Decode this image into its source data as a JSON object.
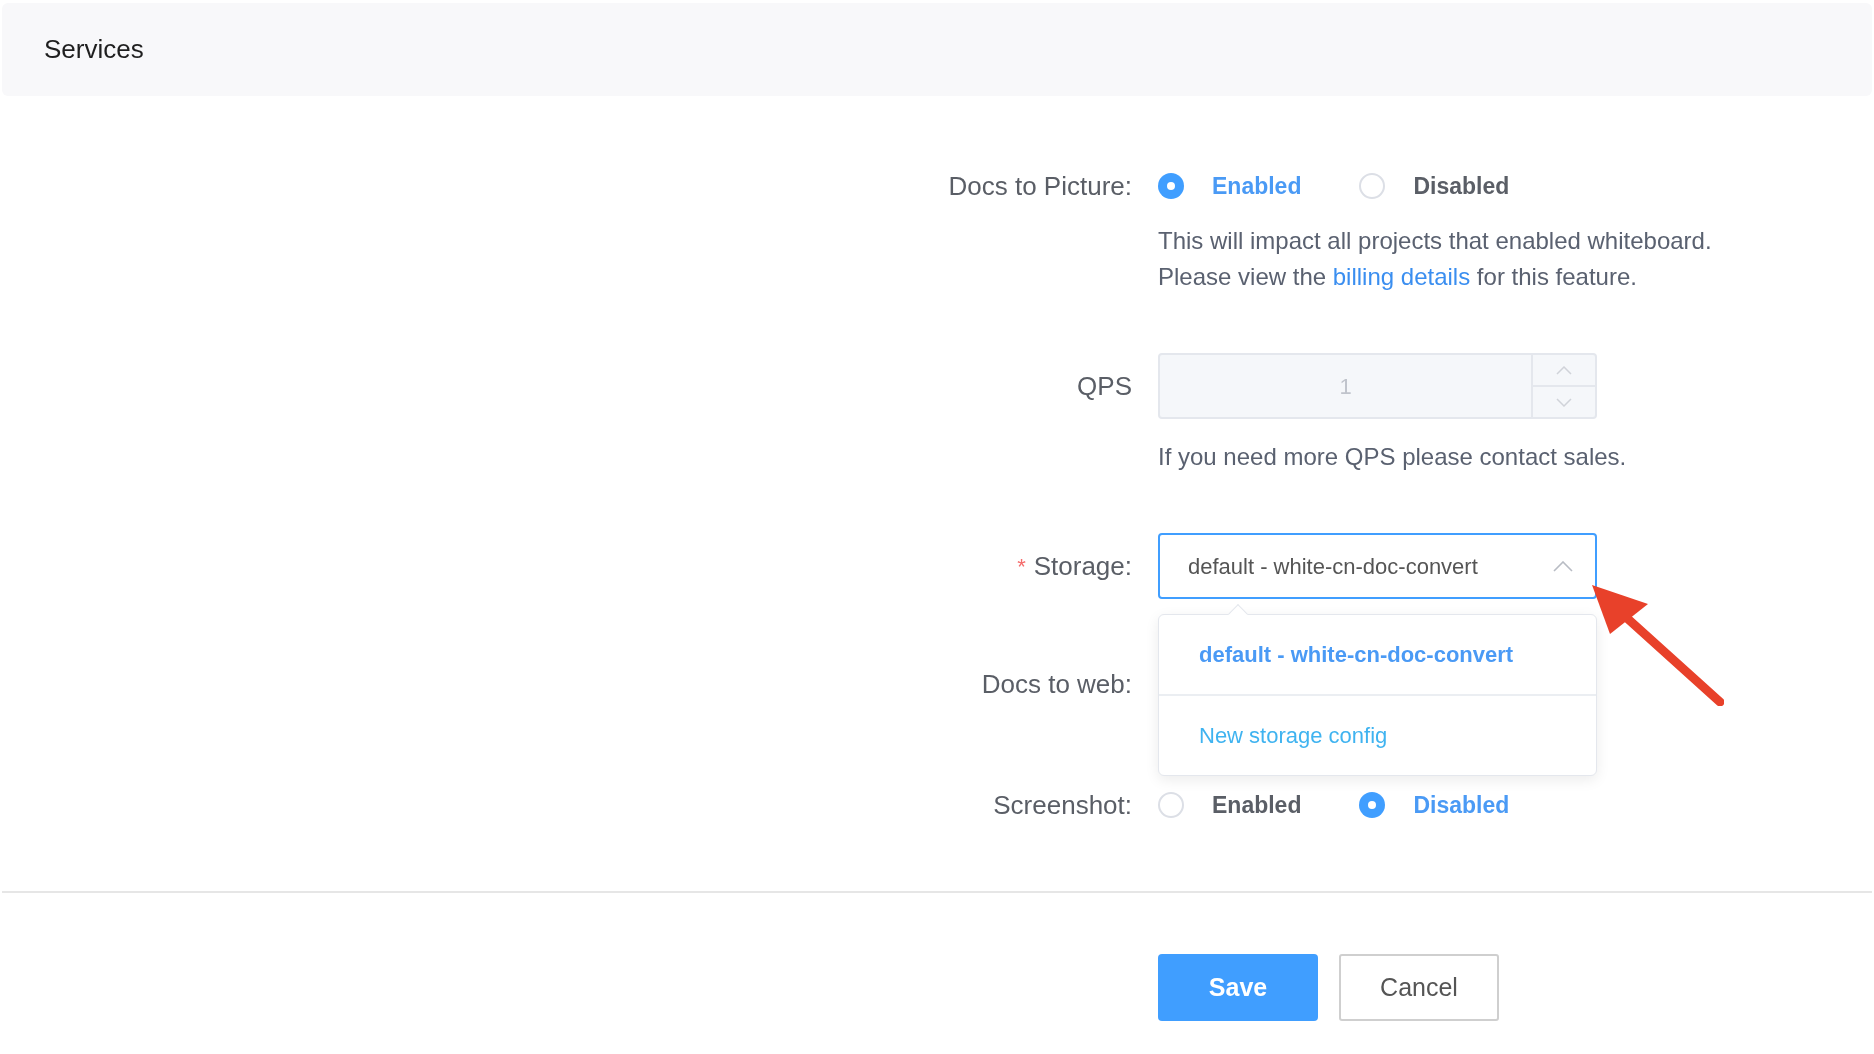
{
  "header": {
    "title": "Services"
  },
  "docs_to_picture": {
    "label": "Docs to Picture:",
    "options": [
      {
        "label": "Enabled",
        "selected": true
      },
      {
        "label": "Disabled",
        "selected": false
      }
    ],
    "note": "This will impact all projects that enabled whiteboard.",
    "billing": {
      "before": "Please view the",
      "link": "billing details",
      "after": "for this feature."
    }
  },
  "qps": {
    "label": "QPS",
    "value": "1",
    "disabled": true,
    "hint": "If you need more QPS please contact sales."
  },
  "storage": {
    "label": "Storage:",
    "required_mark": "*",
    "value": "default - white-cn-doc-convert",
    "open": true,
    "options": [
      {
        "label": "default - white-cn-doc-convert",
        "selected": true
      }
    ],
    "action": "New storage config"
  },
  "docs_to_web": {
    "label": "Docs to web:"
  },
  "screenshot": {
    "label": "Screenshot:",
    "options": [
      {
        "label": "Enabled",
        "selected": false
      },
      {
        "label": "Disabled",
        "selected": true
      }
    ]
  },
  "buttons": {
    "save": "Save",
    "cancel": "Cancel"
  }
}
